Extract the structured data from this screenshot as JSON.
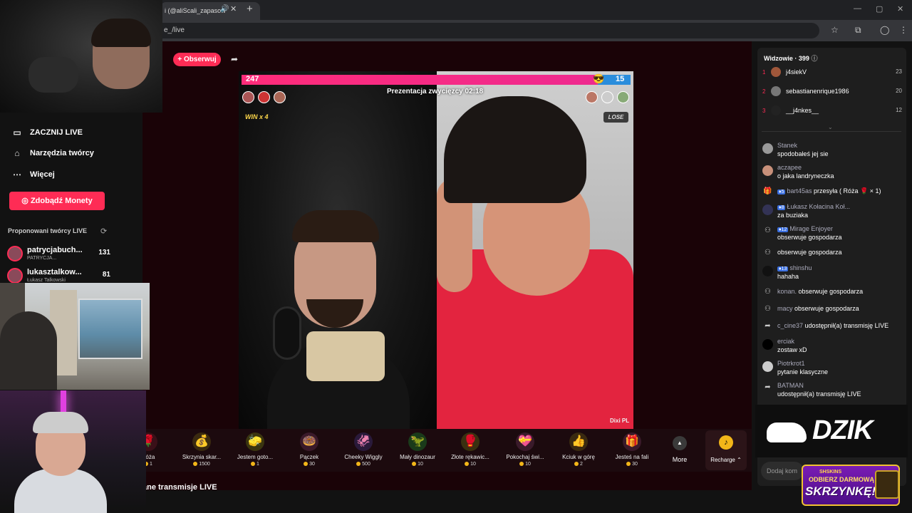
{
  "browser": {
    "tab_title": "i (@aliScali_zapasow",
    "url": "e_/live"
  },
  "sidebar": {
    "nav": [
      {
        "label": "ZACZNIJ LIVE",
        "icon": "video-camera-icon"
      },
      {
        "label": "Narzędzia twórcy",
        "icon": "home-icon"
      },
      {
        "label": "Więcej",
        "icon": "more-dots-icon"
      }
    ],
    "coins_button": "Zdobądź Monety",
    "suggested_title": "Proponowani twórcy LIVE",
    "creators": [
      {
        "name": "patrycjabuch...",
        "sub": "PATRYCJA...",
        "count": "131"
      },
      {
        "name": "lukasztalkow...",
        "sub": "Łukasz Talkowski",
        "count": "81"
      }
    ]
  },
  "stream": {
    "follow_button": "+ Obserwuj",
    "score_left": "247",
    "score_right": "15",
    "round_title": "Prezentacja zwycięzcy 02:18",
    "win_label": "WIN x 4",
    "lose_label": "LOSE",
    "opponent_tag": "Dixi PL"
  },
  "gifts": [
    {
      "name": "Róża",
      "price": "1",
      "icon": "🌹",
      "color": "#3a1018"
    },
    {
      "name": "Skrzynia skar...",
      "price": "1500",
      "icon": "💰",
      "color": "#3a2a10"
    },
    {
      "name": "Jestem goto...",
      "price": "1",
      "icon": "🧽",
      "color": "#3a3510"
    },
    {
      "name": "Pączek",
      "price": "30",
      "icon": "🍩",
      "color": "#3a1a2a"
    },
    {
      "name": "Cheeky Wiggly",
      "price": "500",
      "icon": "🦑",
      "color": "#2a1a3a"
    },
    {
      "name": "Mały dinozaur",
      "price": "10",
      "icon": "🦖",
      "color": "#1a3a1a"
    },
    {
      "name": "Złote rękawic...",
      "price": "10",
      "icon": "🥊",
      "color": "#3a3010"
    },
    {
      "name": "Pokochaj świ...",
      "price": "10",
      "icon": "💝",
      "color": "#3a1a2a"
    },
    {
      "name": "Kciuk w górę",
      "price": "2",
      "icon": "👍",
      "color": "#3a2a10"
    },
    {
      "name": "Jesteś na fali",
      "price": "30",
      "icon": "🎁",
      "color": "#3a1a2a"
    }
  ],
  "more_label": "More",
  "recharge_label": "Recharge",
  "recommended_title": "ane transmisje LIVE",
  "viewers": {
    "title": "Widzowie · 399",
    "top": [
      {
        "rank": "1",
        "name": "j4siekV",
        "score": "23",
        "color": "#a0573a"
      },
      {
        "rank": "2",
        "name": "sebastianenrique1986",
        "score": "20",
        "color": "#777"
      },
      {
        "rank": "3",
        "name": "__j4nkes__",
        "score": "12",
        "color": "#222"
      }
    ]
  },
  "chat": [
    {
      "user": "Stanek",
      "text": "spodobałeś jej sie",
      "kind": "two",
      "av": "#999"
    },
    {
      "user": "aczapee",
      "text": "o jaka landryneczka",
      "kind": "two",
      "av": "#c8907a"
    },
    {
      "level": "5",
      "user": "bart45as",
      "text": "przesyła ( Róża 🌹 × 1)",
      "kind": "one",
      "icon": "gift-icon"
    },
    {
      "level": "8",
      "user": "Łukasz Kołacina Koł...",
      "text": "za buziaka",
      "kind": "two",
      "av": "#335"
    },
    {
      "level": "12",
      "user": "Mirage Enjoyer",
      "text": "obserwuje gospodarza",
      "kind": "two",
      "icon": "follow-icon"
    },
    {
      "user": "",
      "text": "obserwuje gospodarza",
      "kind": "one",
      "icon": "follow-icon"
    },
    {
      "level": "13",
      "user": "shinshu",
      "text": "hahaha",
      "kind": "two",
      "av": "#111"
    },
    {
      "user": "konan.",
      "text": "obserwuje gospodarza",
      "kind": "one",
      "icon": "follow-icon"
    },
    {
      "user": "macy",
      "text": "obserwuje gospodarza",
      "kind": "one",
      "icon": "follow-icon"
    },
    {
      "user": "c_cine37",
      "text": "udostępnił(a) transmisję LIVE",
      "kind": "one",
      "icon": "share-icon"
    },
    {
      "user": "erciak",
      "text": "zostaw xD",
      "kind": "two",
      "av": "#000"
    },
    {
      "user": "Piotrkrot1",
      "text": "pytanie klasyczne",
      "kind": "two",
      "av": "#ccc"
    },
    {
      "user": "BATMAN",
      "text": "udostępnił(a) transmisję LIVE",
      "kind": "two",
      "icon": "share-icon"
    }
  ],
  "chat_input_placeholder": "Dodaj kom",
  "overlay": {
    "dzik": "DZIK",
    "promo_brand": "SHSKINS",
    "promo_line1": "ODBIERZ DARMOWĄ",
    "promo_line2": "SKRZYNKĘ!"
  }
}
